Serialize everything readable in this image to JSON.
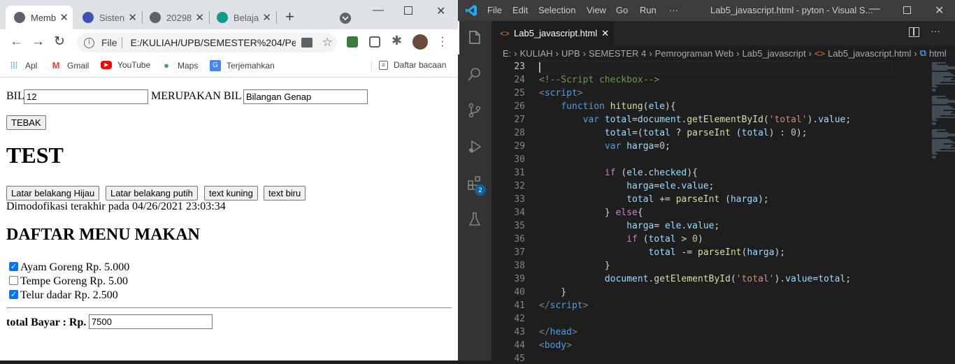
{
  "chrome": {
    "tabs": [
      {
        "title": "Memb",
        "active": true
      },
      {
        "title": "Sisten",
        "active": false
      },
      {
        "title": "20298",
        "active": false
      },
      {
        "title": "Belaja",
        "active": false
      }
    ],
    "new_tab": "+",
    "address": {
      "scheme": "File",
      "url": "E:/KULIAH/UPB/SEMESTER%204/Pe..."
    },
    "bookmarks": [
      {
        "label": "Apl",
        "icon": "apps-grid-icon"
      },
      {
        "label": "Gmail",
        "icon": "gmail-icon"
      },
      {
        "label": "YouTube",
        "icon": "youtube-icon"
      },
      {
        "label": "Maps",
        "icon": "maps-pin-icon"
      },
      {
        "label": "Terjemahkan",
        "icon": "translate-icon"
      }
    ],
    "reading_list": "Daftar bacaan"
  },
  "page": {
    "bil_label": "BIL",
    "bil_value": "12",
    "merupakan_label": "MERUPAKAN BIL",
    "result_value": "Bilangan Genap",
    "tebak_button": "TEBAK",
    "test_heading": "TEST",
    "color_buttons": [
      "Latar belakang Hijau",
      "Latar belakang putih",
      "text kuning",
      "text biru"
    ],
    "modified_text": "Dimodofikasi terakhir pada 04/26/2021 23:03:34",
    "menu_heading": "DAFTAR MENU MAKAN",
    "menu_items": [
      {
        "label": "Ayam Goreng Rp. 5.000",
        "checked": true
      },
      {
        "label": "Tempe Goreng Rp. 5.00",
        "checked": false
      },
      {
        "label": "Telur dadar Rp. 2.500",
        "checked": true
      }
    ],
    "total_label": "total Bayar : Rp.",
    "total_value": "7500"
  },
  "vscode": {
    "menu": [
      "File",
      "Edit",
      "Selection",
      "View",
      "Go",
      "Run",
      "···"
    ],
    "title": "Lab5_javascript.html - pyton - Visual S...",
    "tab": "Lab5_javascript.html",
    "breadcrumb": [
      "E:",
      "KULIAH",
      "UPB",
      "SEMESTER 4",
      "Pemrograman Web",
      "Lab5_javascript",
      "Lab5_javascript.html",
      "html"
    ],
    "extensions_badge": "2",
    "lines": [
      {
        "n": "23",
        "tokens": []
      },
      {
        "n": "24",
        "tokens": [
          [
            "cm",
            "<!--Script checkbox-->"
          ]
        ]
      },
      {
        "n": "25",
        "tokens": [
          [
            "br",
            "<"
          ],
          [
            "tag",
            "script"
          ],
          [
            "br",
            ">"
          ]
        ]
      },
      {
        "n": "26",
        "tokens": [
          [
            "pl",
            "    "
          ],
          [
            "kw",
            "function"
          ],
          [
            "pl",
            " "
          ],
          [
            "fn",
            "hitung"
          ],
          [
            "pl",
            "("
          ],
          [
            "var",
            "ele"
          ],
          [
            "pl",
            "){"
          ]
        ]
      },
      {
        "n": "27",
        "tokens": [
          [
            "pl",
            "        "
          ],
          [
            "kw",
            "var"
          ],
          [
            "pl",
            " "
          ],
          [
            "var",
            "total"
          ],
          [
            "pl",
            "="
          ],
          [
            "var",
            "document"
          ],
          [
            "pl",
            "."
          ],
          [
            "fn",
            "getElementById"
          ],
          [
            "pl",
            "("
          ],
          [
            "str",
            "'total'"
          ],
          [
            "pl",
            ")."
          ],
          [
            "var",
            "value"
          ],
          [
            "pl",
            ";"
          ]
        ]
      },
      {
        "n": "28",
        "tokens": [
          [
            "pl",
            "            "
          ],
          [
            "var",
            "total"
          ],
          [
            "pl",
            "=("
          ],
          [
            "var",
            "total"
          ],
          [
            "pl",
            " ? "
          ],
          [
            "fn",
            "parseInt"
          ],
          [
            "pl",
            " ("
          ],
          [
            "var",
            "total"
          ],
          [
            "pl",
            ") : "
          ],
          [
            "num",
            "0"
          ],
          [
            "pl",
            ");"
          ]
        ]
      },
      {
        "n": "29",
        "tokens": [
          [
            "pl",
            "            "
          ],
          [
            "kw",
            "var"
          ],
          [
            "pl",
            " "
          ],
          [
            "var",
            "harga"
          ],
          [
            "pl",
            "="
          ],
          [
            "num",
            "0"
          ],
          [
            "pl",
            ";"
          ]
        ]
      },
      {
        "n": "30",
        "tokens": []
      },
      {
        "n": "31",
        "tokens": [
          [
            "pl",
            "            "
          ],
          [
            "ctl",
            "if"
          ],
          [
            "pl",
            " ("
          ],
          [
            "var",
            "ele"
          ],
          [
            "pl",
            "."
          ],
          [
            "var",
            "checked"
          ],
          [
            "pl",
            "){"
          ]
        ]
      },
      {
        "n": "32",
        "tokens": [
          [
            "pl",
            "                "
          ],
          [
            "var",
            "harga"
          ],
          [
            "pl",
            "="
          ],
          [
            "var",
            "ele"
          ],
          [
            "pl",
            "."
          ],
          [
            "var",
            "value"
          ],
          [
            "pl",
            ";"
          ]
        ]
      },
      {
        "n": "33",
        "tokens": [
          [
            "pl",
            "                "
          ],
          [
            "var",
            "total"
          ],
          [
            "pl",
            " += "
          ],
          [
            "fn",
            "parseInt"
          ],
          [
            "pl",
            " ("
          ],
          [
            "var",
            "harga"
          ],
          [
            "pl",
            ");"
          ]
        ]
      },
      {
        "n": "34",
        "tokens": [
          [
            "pl",
            "            } "
          ],
          [
            "ctl",
            "else"
          ],
          [
            "pl",
            "{"
          ]
        ]
      },
      {
        "n": "35",
        "tokens": [
          [
            "pl",
            "                "
          ],
          [
            "var",
            "harga"
          ],
          [
            "pl",
            "= "
          ],
          [
            "var",
            "ele"
          ],
          [
            "pl",
            "."
          ],
          [
            "var",
            "value"
          ],
          [
            "pl",
            ";"
          ]
        ]
      },
      {
        "n": "36",
        "tokens": [
          [
            "pl",
            "                "
          ],
          [
            "ctl",
            "if"
          ],
          [
            "pl",
            " ("
          ],
          [
            "var",
            "total"
          ],
          [
            "pl",
            " > "
          ],
          [
            "num",
            "0"
          ],
          [
            "pl",
            ")"
          ]
        ]
      },
      {
        "n": "37",
        "tokens": [
          [
            "pl",
            "                    "
          ],
          [
            "var",
            "total"
          ],
          [
            "pl",
            " -= "
          ],
          [
            "fn",
            "parseInt"
          ],
          [
            "pl",
            "("
          ],
          [
            "var",
            "harga"
          ],
          [
            "pl",
            ");"
          ]
        ]
      },
      {
        "n": "38",
        "tokens": [
          [
            "pl",
            "            }"
          ]
        ]
      },
      {
        "n": "39",
        "tokens": [
          [
            "pl",
            "            "
          ],
          [
            "var",
            "document"
          ],
          [
            "pl",
            "."
          ],
          [
            "fn",
            "getElementById"
          ],
          [
            "pl",
            "("
          ],
          [
            "str",
            "'total'"
          ],
          [
            "pl",
            ")."
          ],
          [
            "var",
            "value"
          ],
          [
            "pl",
            "="
          ],
          [
            "var",
            "total"
          ],
          [
            "pl",
            ";"
          ]
        ]
      },
      {
        "n": "40",
        "tokens": [
          [
            "pl",
            "    }"
          ]
        ]
      },
      {
        "n": "41",
        "tokens": [
          [
            "br",
            "</"
          ],
          [
            "tag",
            "script"
          ],
          [
            "br",
            ">"
          ]
        ]
      },
      {
        "n": "42",
        "tokens": []
      },
      {
        "n": "43",
        "tokens": [
          [
            "br",
            "</"
          ],
          [
            "tag",
            "head"
          ],
          [
            "br",
            ">"
          ]
        ]
      },
      {
        "n": "44",
        "tokens": [
          [
            "br",
            "<"
          ],
          [
            "tag",
            "body"
          ],
          [
            "br",
            ">"
          ]
        ]
      },
      {
        "n": "45",
        "tokens": []
      }
    ]
  }
}
